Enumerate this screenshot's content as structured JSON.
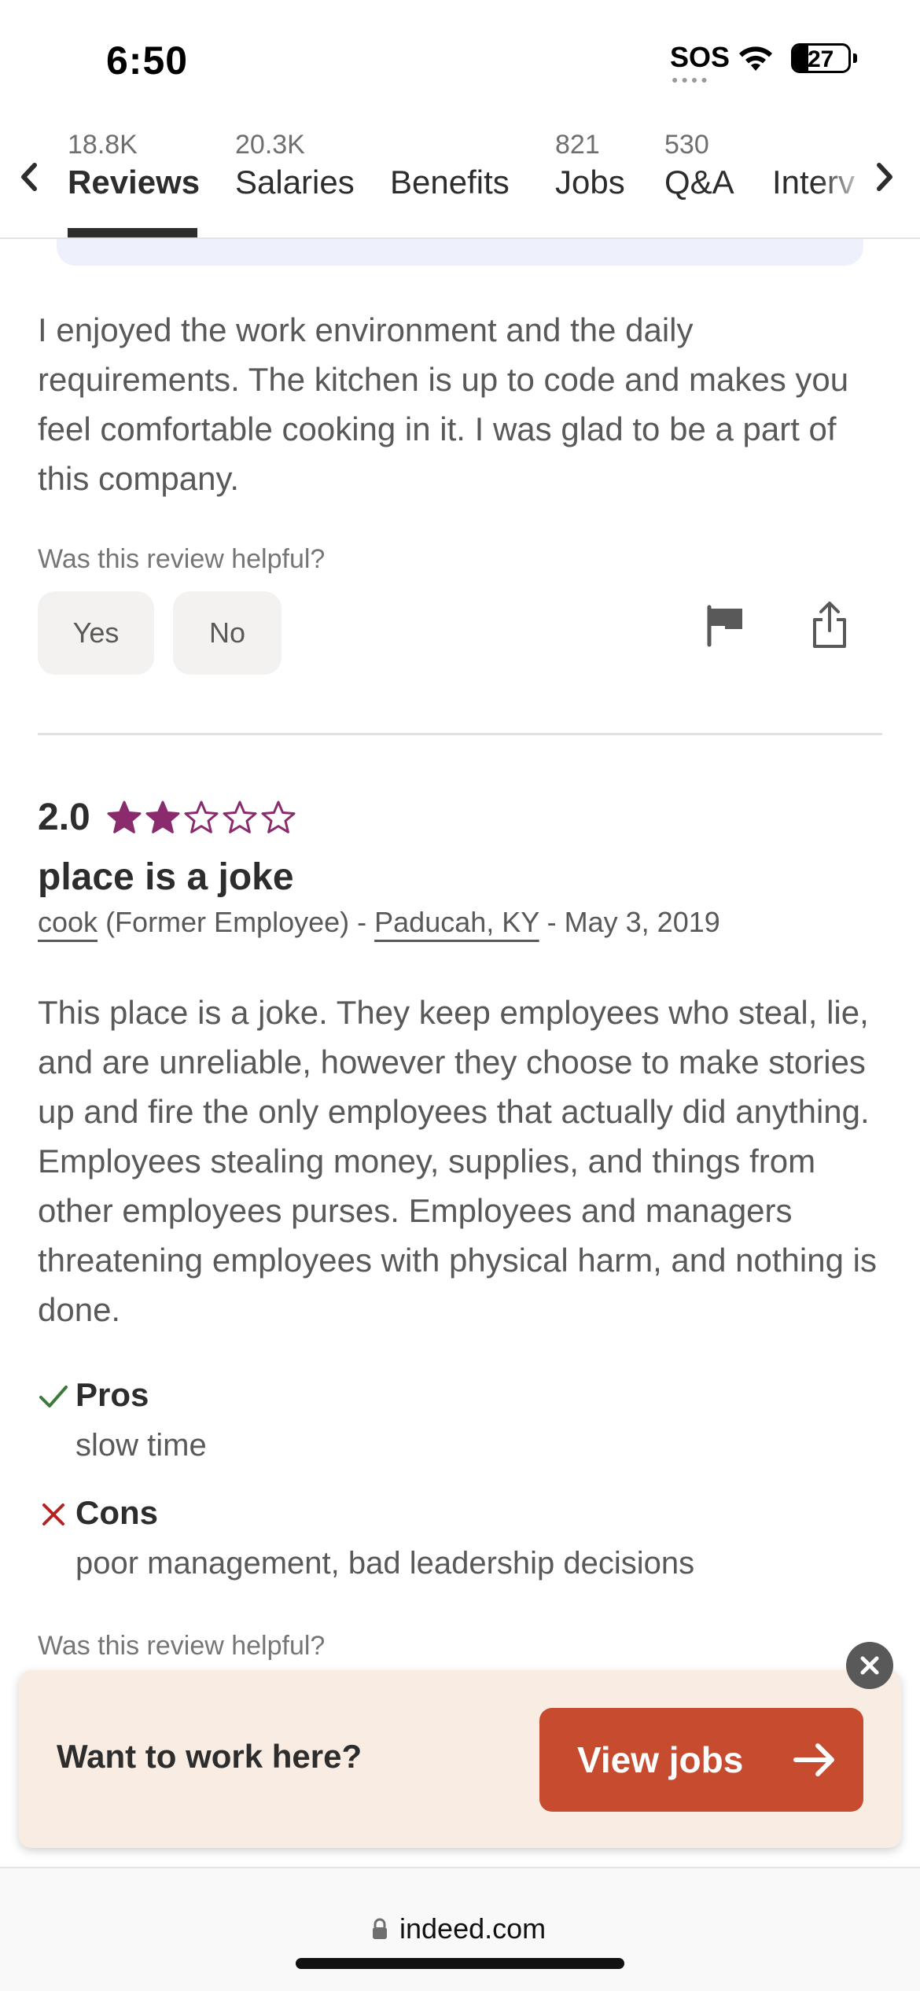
{
  "status_bar": {
    "time": "6:50",
    "sos": "SOS",
    "battery_level": "27",
    "battery_fraction": 0.27
  },
  "tabs": [
    {
      "count": "18.8K",
      "label": "Reviews",
      "active": true
    },
    {
      "count": "20.3K",
      "label": "Salaries",
      "active": false
    },
    {
      "count": "",
      "label": "Benefits",
      "active": false
    },
    {
      "count": "821",
      "label": "Jobs",
      "active": false
    },
    {
      "count": "530",
      "label": "Q&A",
      "active": false
    },
    {
      "count": "",
      "label": "Interv",
      "active": false
    }
  ],
  "review1": {
    "body": "I enjoyed the work environment and the daily requirements. The kitchen is up to code and makes you feel comfortable cooking in it. I was glad to be a part of this company.",
    "helpful_prompt": "Was this review helpful?",
    "yes_label": "Yes",
    "no_label": "No"
  },
  "review2": {
    "rating": "2.0",
    "rating_value": 2,
    "rating_max": 5,
    "title": "place is a joke",
    "job_title": "cook",
    "employment": "(Former Employee) -",
    "location": "Paducah, KY",
    "date": "- May 3, 2019",
    "body": "This place is a joke. They keep employees who steal, lie, and are unreliable, however they choose to make stories up and fire the only employees that actually did anything. Employees stealing money, supplies, and things from other employees purses. Employees and managers threatening employees with physical harm, and nothing is done.",
    "pros_label": "Pros",
    "pros_text": "slow time",
    "cons_label": "Cons",
    "cons_text": "poor management, bad leadership decisions",
    "helpful_prompt": "Was this review helpful?"
  },
  "banner": {
    "text": "Want to work here?",
    "button_label": "View jobs"
  },
  "url_bar": {
    "domain": "indeed.com"
  },
  "colors": {
    "star": "#8a2b6e",
    "accent_button": "#c74b2e",
    "banner_bg": "#f9ede3",
    "pros_check": "#3b7a3b",
    "cons_x": "#b32424"
  },
  "icons": [
    "chevron-left-icon",
    "chevron-right-icon",
    "wifi-icon",
    "flag-icon",
    "share-icon",
    "check-icon",
    "x-icon",
    "close-icon",
    "arrow-right-icon",
    "lock-icon"
  ]
}
